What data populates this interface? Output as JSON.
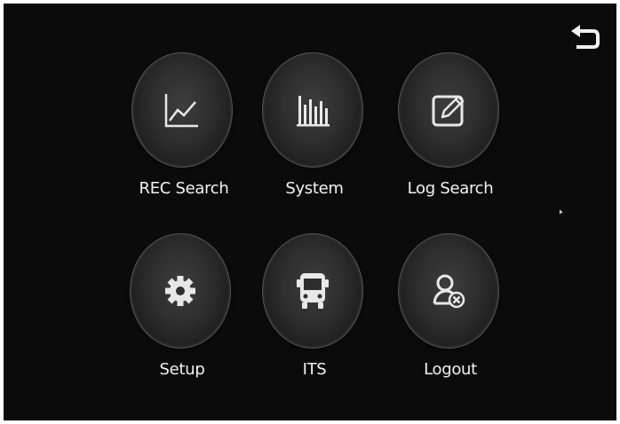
{
  "menu": {
    "items": [
      {
        "label": "REC Search",
        "icon": "line-chart-icon"
      },
      {
        "label": "System",
        "icon": "bar-chart-icon"
      },
      {
        "label": "Log Search",
        "icon": "edit-note-icon"
      },
      {
        "label": "Setup",
        "icon": "gear-icon"
      },
      {
        "label": "ITS",
        "icon": "bus-icon"
      },
      {
        "label": "Logout",
        "icon": "logout-user-icon"
      }
    ]
  },
  "back": {
    "icon": "back-arrow-icon"
  },
  "colors": {
    "background": "#0b0b0b",
    "button": "#2e2e2e",
    "text": "#f2f2f2",
    "icon": "#e8e8e8"
  }
}
